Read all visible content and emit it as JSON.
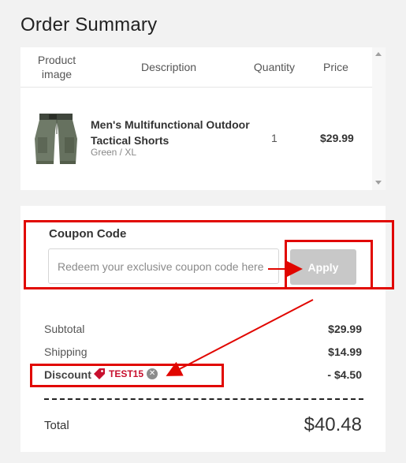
{
  "page": {
    "title": "Order Summary"
  },
  "cart": {
    "headers": {
      "image": "Product image",
      "description": "Description",
      "quantity": "Quantity",
      "price": "Price"
    },
    "items": [
      {
        "thumbnail": "product-thumbnail-shorts",
        "name": "Men's Multifunctional Outdoor Tactical Shorts",
        "variant": "Green / XL",
        "quantity": "1",
        "price": "$29.99"
      }
    ]
  },
  "coupon": {
    "label": "Coupon Code",
    "placeholder": "Redeem your exclusive coupon code here",
    "value": "",
    "apply_label": "Apply"
  },
  "totals": {
    "subtotal_label": "Subtotal",
    "subtotal_value": "$29.99",
    "shipping_label": "Shipping",
    "shipping_value": "$14.99",
    "discount_label": "Discount",
    "discount_code": "TEST15",
    "discount_value": "- $4.50",
    "total_label": "Total",
    "total_value": "$40.48"
  },
  "colors": {
    "annotation": "#e10600",
    "tag": "#c8102e",
    "apply_button": "#c8c8c8"
  },
  "icons": [
    "tag-icon",
    "remove-icon",
    "scroll-up-icon",
    "scroll-down-icon"
  ]
}
